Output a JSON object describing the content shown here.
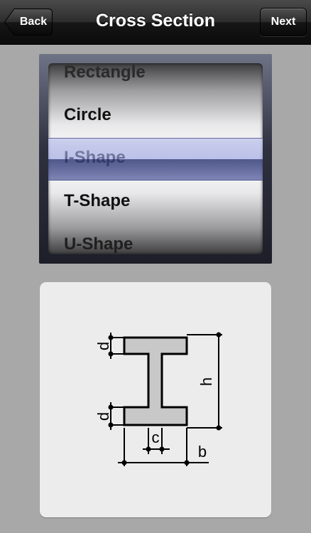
{
  "nav": {
    "title": "Cross Section",
    "back_label": "Back",
    "next_label": "Next"
  },
  "picker": {
    "options": [
      "Rectangle",
      "Circle",
      "I-Shape",
      "T-Shape",
      "U-Shape"
    ],
    "selected": "I-Shape",
    "selection_tint": "#8f97d8"
  },
  "diagram": {
    "shape": "I-Shape",
    "labels": {
      "d_top": "d",
      "d_bottom": "d",
      "h": "h",
      "c": "c",
      "b": "b"
    },
    "fill_color": "#c8c8c8",
    "stroke_color": "#000000"
  }
}
